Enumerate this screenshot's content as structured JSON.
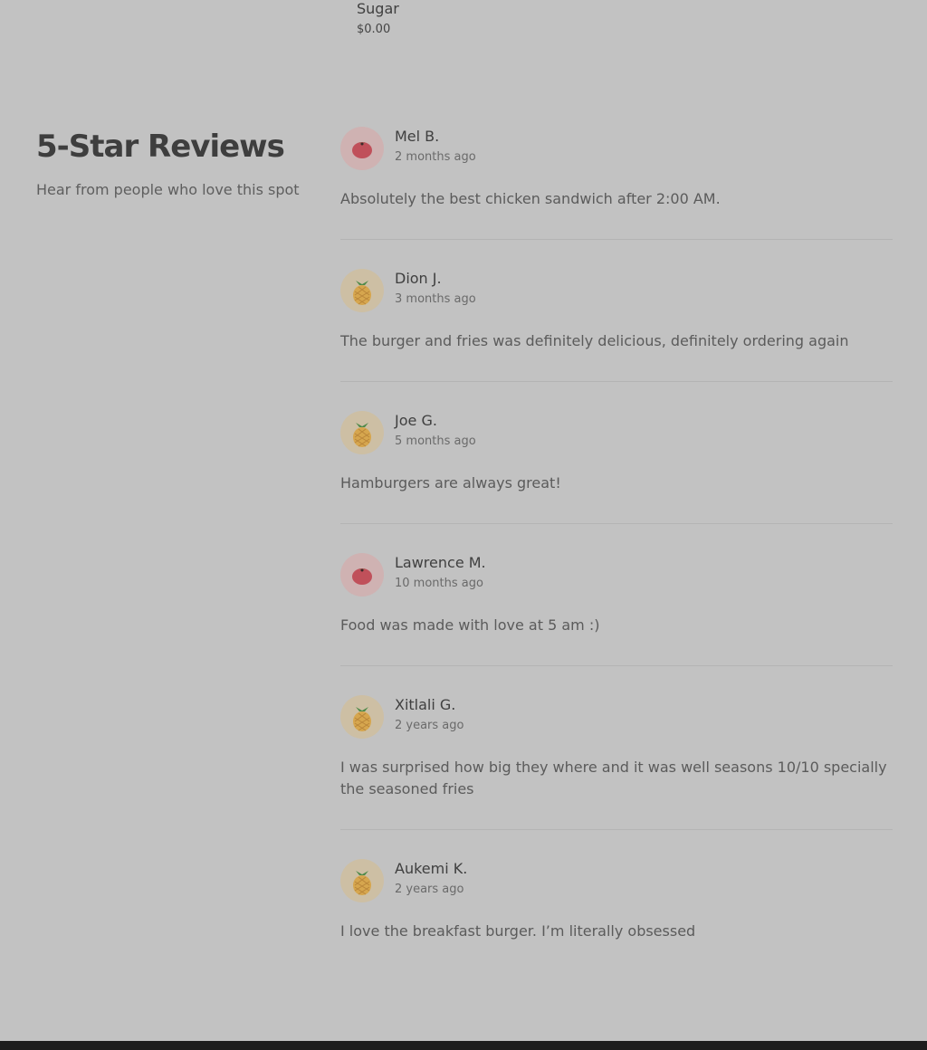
{
  "top_item": {
    "name": "Sugar",
    "price": "$0.00"
  },
  "section": {
    "title": "5-Star Reviews",
    "subtitle": "Hear from people who love this spot"
  },
  "reviews": [
    {
      "name": "Mel B.",
      "time": "2 months ago",
      "text": "Absolutely the best chicken sandwich after 2:00 AM.",
      "avatar": "tomato-icon"
    },
    {
      "name": "Dion J.",
      "time": "3 months ago",
      "text": "The burger and fries was definitely delicious, definitely ordering again",
      "avatar": "pineapple-icon"
    },
    {
      "name": "Joe G.",
      "time": "5 months ago",
      "text": "Hamburgers are always great!",
      "avatar": "pineapple-icon"
    },
    {
      "name": "Lawrence M.",
      "time": "10 months ago",
      "text": "Food was made with love at 5 am :)",
      "avatar": "tomato-icon"
    },
    {
      "name": "Xitlali G.",
      "time": "2 years ago",
      "text": "I was surprised how big they where and it was well seasons 10/10 specially the seasoned fries",
      "avatar": "pineapple-icon"
    },
    {
      "name": "Aukemi K.",
      "time": "2 years ago",
      "text": "I love the breakfast burger. I’m literally obsessed",
      "avatar": "pineapple-icon"
    }
  ],
  "colors": {
    "background": "#c2c2c2",
    "tomato": "#c0505a",
    "pineapple": "#d6a64e",
    "leaf": "#4f8a4a"
  }
}
